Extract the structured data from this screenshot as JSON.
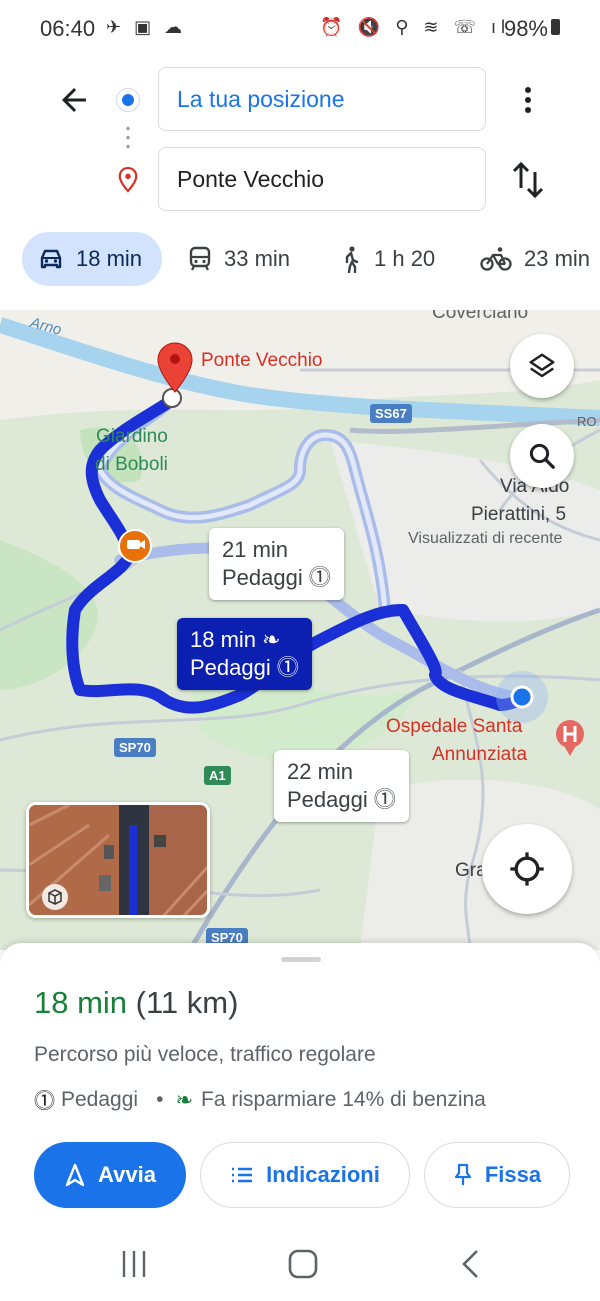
{
  "status_bar": {
    "time": "06:40",
    "battery": "98%"
  },
  "directions": {
    "origin_value": "La tua posizione",
    "destination_value": "Ponte Vecchio"
  },
  "modes": [
    {
      "name": "car-icon",
      "label": "18 min",
      "active": true
    },
    {
      "name": "transit-icon",
      "label": "33 min",
      "active": false
    },
    {
      "name": "walk-icon",
      "label": "1 h 20",
      "active": false
    },
    {
      "name": "bike-icon",
      "label": "23 min",
      "active": false
    }
  ],
  "map": {
    "labels": {
      "destination": "Ponte Vecchio",
      "river": "Arno",
      "park_line1": "Giardino",
      "park_line2": "di Boboli",
      "coverciano": "Coverciano",
      "street_line1": "Via Aldo",
      "street_line2": "Pierattini, 5",
      "street_hint": "Visualizzati di recente",
      "hospital_line1": "Ospedale Santa",
      "hospital_line2": "Annunziata",
      "gra": "Gra",
      "ro": "RO"
    },
    "road_badges": [
      "SS67",
      "SP70",
      "A1",
      "SP70"
    ],
    "routes": [
      {
        "time": "18 min",
        "note": "Pedaggi",
        "selected": true
      },
      {
        "time": "21 min",
        "note": "Pedaggi",
        "selected": false
      },
      {
        "time": "22 min",
        "note": "Pedaggi",
        "selected": false
      }
    ]
  },
  "sheet": {
    "duration": "18 min",
    "distance": "(11 km)",
    "description": "Percorso più veloce, traffico regolare",
    "tolls": "Pedaggi",
    "fuel": "Fa risparmiare 14% di benzina",
    "buttons": {
      "start": "Avvia",
      "steps": "Indicazioni",
      "pin": "Fissa"
    }
  },
  "colors": {
    "accent": "#1a73e8",
    "route_selected": "#1a2fd6",
    "route_alt": "#a9bcea",
    "duration_green": "#188038",
    "pin_red": "#ea4335"
  }
}
